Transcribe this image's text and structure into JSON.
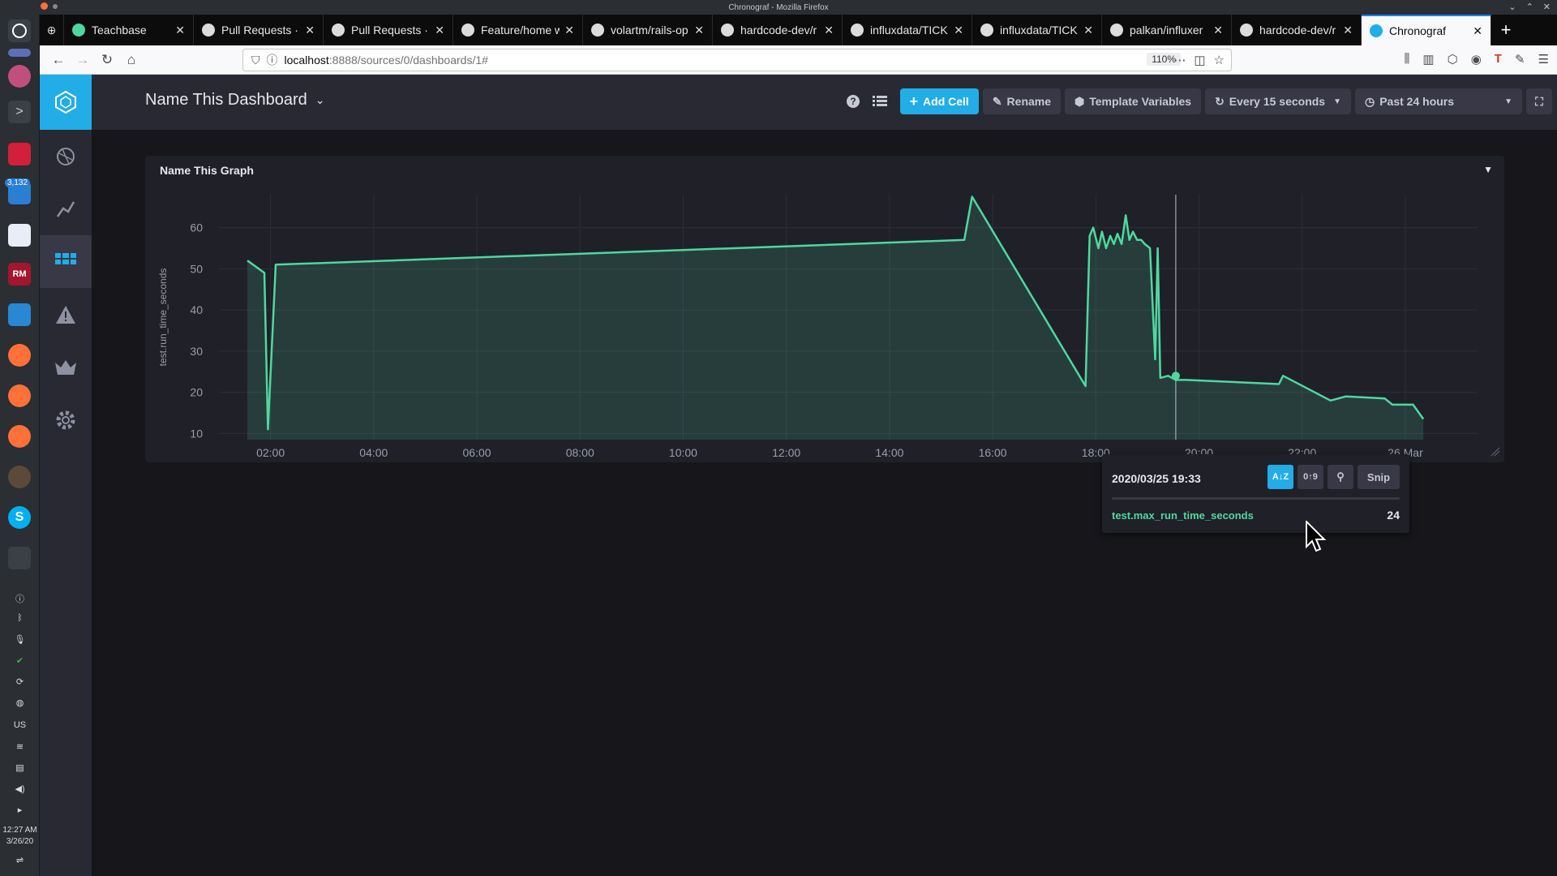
{
  "window": {
    "title": "Chronograf - Mozilla Firefox"
  },
  "tabs": [
    {
      "label": "Teachbase",
      "favicon_color": "#4ed8a0"
    },
    {
      "label": "Pull Requests · ",
      "favicon_color": "#dcdcdc"
    },
    {
      "label": "Pull Requests · ",
      "favicon_color": "#dcdcdc"
    },
    {
      "label": "Feature/home w",
      "favicon_color": "#dcdcdc"
    },
    {
      "label": "volartm/rails-op",
      "favicon_color": "#dcdcdc"
    },
    {
      "label": "hardcode-dev/r",
      "favicon_color": "#dcdcdc"
    },
    {
      "label": "influxdata/TICK",
      "favicon_color": "#dcdcdc"
    },
    {
      "label": "influxdata/TICK",
      "favicon_color": "#dcdcdc"
    },
    {
      "label": "palkan/influxer",
      "favicon_color": "#dcdcdc"
    },
    {
      "label": "hardcode-dev/r",
      "favicon_color": "#dcdcdc"
    },
    {
      "label": "Chronograf",
      "favicon_color": "#22ade6",
      "active": true
    }
  ],
  "address": {
    "host": "localhost",
    "path": ":8888/sources/0/dashboards/1#",
    "zoom": "110%"
  },
  "taskbar": {
    "badge": "3,132",
    "clock_time": "12:27 AM",
    "clock_date": "3/26/20",
    "keyboard": "US"
  },
  "dashboard": {
    "title": "Name This Dashboard",
    "add_cell": "Add Cell",
    "rename": "Rename",
    "template_variables": "Template Variables",
    "refresh": "Every 15 seconds",
    "time_range": "Past 24 hours"
  },
  "cell": {
    "title": "Name This Graph"
  },
  "tooltip": {
    "time": "2020/03/25 19:33",
    "sort_az": "A↓Z",
    "sort_09": "0↑9",
    "snip": "Snip",
    "series_name": "test.max_run_time_seconds",
    "value": "24"
  },
  "colors": {
    "accent": "#22ade6",
    "series": "#4ed8a0",
    "panel": "#202028",
    "page": "#16161b"
  },
  "chart_data": {
    "type": "area",
    "ylabel": "test.run_time_seconds",
    "xlabel": "",
    "ylim": [
      8.5,
      68
    ],
    "yticks": [
      10,
      20,
      30,
      40,
      50,
      60
    ],
    "xlim": [
      0.0,
      24.4
    ],
    "xticks": [
      {
        "h": 1.0,
        "label": "02:00"
      },
      {
        "h": 3.0,
        "label": "04:00"
      },
      {
        "h": 5.0,
        "label": "06:00"
      },
      {
        "h": 7.0,
        "label": "08:00"
      },
      {
        "h": 9.0,
        "label": "10:00"
      },
      {
        "h": 11.0,
        "label": "12:00"
      },
      {
        "h": 13.0,
        "label": "14:00"
      },
      {
        "h": 15.0,
        "label": "16:00"
      },
      {
        "h": 17.0,
        "label": "18:00"
      },
      {
        "h": 19.0,
        "label": "20:00"
      },
      {
        "h": 21.0,
        "label": "22:00"
      },
      {
        "h": 23.0,
        "label": "26 Mar"
      }
    ],
    "series": [
      {
        "name": "test.max_run_time_seconds",
        "x": [
          0.55,
          0.88,
          0.95,
          1.1,
          14.45,
          14.6,
          16.8,
          16.88,
          16.95,
          17.05,
          17.12,
          17.2,
          17.28,
          17.35,
          17.42,
          17.5,
          17.58,
          17.65,
          17.72,
          17.8,
          17.88,
          17.95,
          18.05,
          18.15,
          18.2,
          18.25,
          18.4,
          18.55,
          18.75,
          20.55,
          20.63,
          21.55,
          21.85,
          22.6,
          22.75,
          23.15,
          23.35
        ],
        "y": [
          52,
          49,
          11,
          51,
          57,
          67.5,
          21.5,
          58,
          60,
          55,
          59,
          55,
          58,
          56,
          58.5,
          56,
          63,
          57,
          59,
          57,
          57,
          56,
          55,
          28,
          55,
          23.5,
          24,
          23,
          23,
          22,
          24,
          18,
          19,
          18.5,
          17,
          17,
          13.5
        ]
      }
    ],
    "hover": {
      "time": "2020/03/25 19:33",
      "value": 24
    },
    "grid": true
  }
}
